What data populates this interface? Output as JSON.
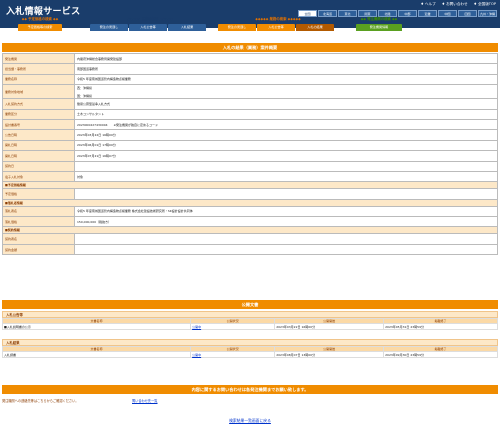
{
  "header": {
    "title": "入札情報サービス",
    "links": [
      "♦ ヘルプ",
      "♦ お問い合わせ",
      "♦ 全国版TOP"
    ],
    "regions_row1": [
      "全国",
      "北海道",
      "東北",
      "関東",
      "北陸",
      "中部",
      "近畿",
      "中国",
      "四国",
      "九州・沖縄"
    ],
    "regions_row2": [
      "全国",
      "北海道",
      "東北",
      "関東"
    ]
  },
  "nav": {
    "groups": [
      {
        "label": "◆◆ 予定価格の検索 ◆◆",
        "tabs": [
          "予定価格等の検索"
        ]
      },
      {
        "label": "◆◆◆◆◆ 工事の検索 ◆◆◆◆◆",
        "tabs": [
          "発注の見通し",
          "入札公告等",
          "入札結果"
        ]
      },
      {
        "label": "◆◆◆◆◆ 業務の検索 ◆◆◆◆◆",
        "tabs": [
          "発注の見通し",
          "入札公告等",
          "入札の結果"
        ]
      },
      {
        "label": "◆◆ 発注機関の検索 ◆◆",
        "tabs": [
          "発注機関情報"
        ]
      }
    ]
  },
  "page_title": "入札の結果（業務）案件概要",
  "fields": [
    {
      "k": "発注機関",
      "v": "内閣府沖縄総合事務局開発建設部"
    },
    {
      "k": "担当課・事務所",
      "v": "南部国道事務所"
    },
    {
      "k": "業務名称",
      "v": "令和5 年度南城国道管内構造物点検業務"
    },
    {
      "k": "業務対象地域",
      "v": "西：沖縄県\n\n国：沖縄県"
    },
    {
      "k": "入札契約方式",
      "v": "簡易公募型競争入札方式"
    },
    {
      "k": "業務区分",
      "v": "土木コンサルタント"
    },
    {
      "k": "設計書番号",
      "v": "2023000227430004　　※発注機関が独自に定めるコード"
    },
    {
      "k": "公告日時",
      "v": "2023年03月22日 16時00分"
    },
    {
      "k": "開札日時",
      "v": "2023年06月01日 17時00分"
    },
    {
      "k": "開札日時",
      "v": "2023年07月21日 16時07分"
    },
    {
      "k": "契約日",
      "v": ""
    },
    {
      "k": "電子入札対象",
      "v": "対象"
    }
  ],
  "section_price": "■予定価格情報",
  "price_fields": [
    {
      "k": "予定価格",
      "v": ""
    }
  ],
  "section_bid": "■落札者情報",
  "bid_fields": [
    {
      "k": "落札者名",
      "v": "令和5 年度南城国道管内構造物点検業務 株式会社建設技術研究所・SK設計設計共同体"
    },
    {
      "k": "落札価格",
      "v": "150,000,000（税抜き）"
    }
  ],
  "section_contract": "■契約情報",
  "contract_fields": [
    {
      "k": "契約者名",
      "v": ""
    },
    {
      "k": "契約金額",
      "v": ""
    }
  ],
  "docs_title": "公開文書",
  "docs_notice": {
    "head": "入札公告等",
    "cols": [
      "文書名称",
      "公開状況",
      "公開開始",
      "掲載終了"
    ],
    "rows": [
      [
        "■入札説明書の公示",
        "公開中",
        "2023年03月22日 16時00分",
        "2023年05月31日 23時59分"
      ]
    ]
  },
  "docs_result": {
    "head": "入札結果",
    "cols": [
      "文書名称",
      "公開状況",
      "公開開始",
      "掲載終了"
    ],
    "rows": [
      [
        "入札調書",
        "公開中",
        "2023年08月07日 13時00分",
        "2023年09月30日 23時59分"
      ]
    ]
  },
  "inquiry_band": "内容に関するお問い合わせは各発注機関までお願い致します。",
  "inquiry_label": "発注機関への連絡先等はこちらからご確認ください。",
  "inquiry_link": "問い合わせ先一覧",
  "back_link": "検索結果一覧画面に戻る"
}
